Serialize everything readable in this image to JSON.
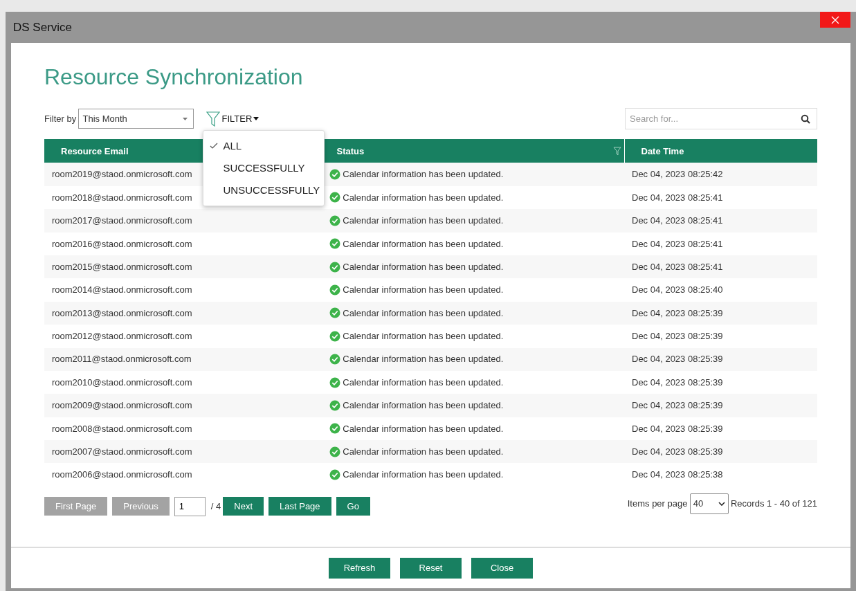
{
  "window": {
    "title": "DS Service"
  },
  "heading": "Resource Synchronization",
  "filter_by": {
    "label": "Filter by",
    "value": "This Month"
  },
  "filter_button": {
    "label": "FILTER"
  },
  "filter_menu": [
    {
      "label": "ALL",
      "selected": true
    },
    {
      "label": "SUCCESSFULLY",
      "selected": false
    },
    {
      "label": "UNSUCCESSFULLY",
      "selected": false
    }
  ],
  "search": {
    "placeholder": "Search for..."
  },
  "table": {
    "columns": [
      {
        "label": "Resource Email"
      },
      {
        "label": "Status",
        "filter": true
      },
      {
        "label": "Date Time",
        "filter": false
      }
    ],
    "rows": [
      {
        "email": "room2019@staod.onmicrosoft.com",
        "kind": "success",
        "message": "Calendar information has been updated.",
        "time": "Dec 04, 2023 08:25:42"
      },
      {
        "email": "room2018@staod.onmicrosoft.com",
        "kind": "success",
        "message": "Calendar information has been updated.",
        "time": "Dec 04, 2023 08:25:41"
      },
      {
        "email": "room2017@staod.onmicrosoft.com",
        "kind": "success",
        "message": "Calendar information has been updated.",
        "time": "Dec 04, 2023 08:25:41"
      },
      {
        "email": "room2016@staod.onmicrosoft.com",
        "kind": "success",
        "message": "Calendar information has been updated.",
        "time": "Dec 04, 2023 08:25:41"
      },
      {
        "email": "room2015@staod.onmicrosoft.com",
        "kind": "success",
        "message": "Calendar information has been updated.",
        "time": "Dec 04, 2023 08:25:41"
      },
      {
        "email": "room2014@staod.onmicrosoft.com",
        "kind": "success",
        "message": "Calendar information has been updated.",
        "time": "Dec 04, 2023 08:25:40"
      },
      {
        "email": "room2013@staod.onmicrosoft.com",
        "kind": "success",
        "message": "Calendar information has been updated.",
        "time": "Dec 04, 2023 08:25:39"
      },
      {
        "email": "room2012@staod.onmicrosoft.com",
        "kind": "success",
        "message": "Calendar information has been updated.",
        "time": "Dec 04, 2023 08:25:39"
      },
      {
        "email": "room2011@staod.onmicrosoft.com",
        "kind": "success",
        "message": "Calendar information has been updated.",
        "time": "Dec 04, 2023 08:25:39"
      },
      {
        "email": "room2010@staod.onmicrosoft.com",
        "kind": "success",
        "message": "Calendar information has been updated.",
        "time": "Dec 04, 2023 08:25:39"
      },
      {
        "email": "room2009@staod.onmicrosoft.com",
        "kind": "success",
        "message": "Calendar information has been updated.",
        "time": "Dec 04, 2023 08:25:39"
      },
      {
        "email": "room2008@staod.onmicrosoft.com",
        "kind": "success",
        "message": "Calendar information has been updated.",
        "time": "Dec 04, 2023 08:25:39"
      },
      {
        "email": "room2007@staod.onmicrosoft.com",
        "kind": "success",
        "message": "Calendar information has been updated.",
        "time": "Dec 04, 2023 08:25:39"
      },
      {
        "email": "room2006@staod.onmicrosoft.com",
        "kind": "success",
        "message": "Calendar information has been updated.",
        "time": "Dec 04, 2023 08:25:38"
      }
    ]
  },
  "pagination": {
    "buttons_before": [
      {
        "label": "First Page",
        "disabled": true
      },
      {
        "label": "Previous",
        "disabled": true
      }
    ],
    "page": "1",
    "of": "/ 4",
    "buttons_after": [
      {
        "label": "Next",
        "disabled": false
      },
      {
        "label": "Last Page",
        "disabled": false
      },
      {
        "label": "Go",
        "disabled": false
      }
    ],
    "items_label": "Items per page",
    "items_value": "40",
    "records": "Records 1 - 40 of 121"
  },
  "footer_buttons": [
    "Refresh",
    "Reset",
    "Close"
  ]
}
